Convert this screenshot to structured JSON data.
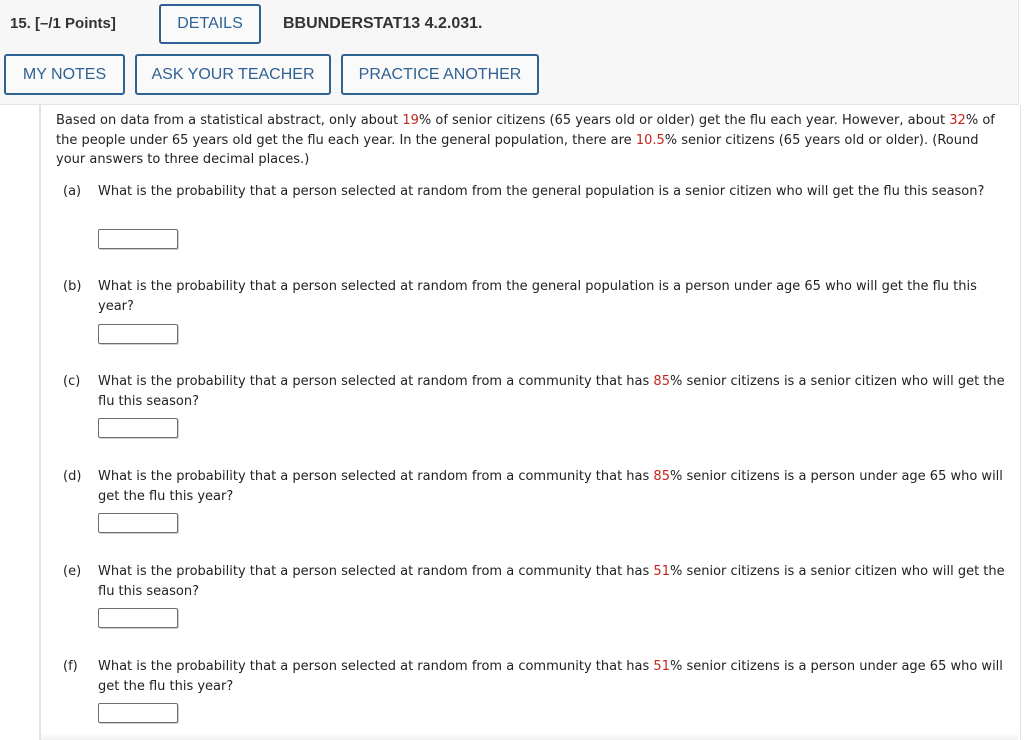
{
  "header": {
    "question_number": "15.  [–/1 Points]",
    "details_label": "DETAILS",
    "question_code": "BBUNDERSTAT13 4.2.031.",
    "my_notes_label": "MY NOTES",
    "ask_teacher_label": "ASK YOUR TEACHER",
    "practice_label": "PRACTICE ANOTHER"
  },
  "colors": {
    "accent": "#2f6193",
    "highlight": "#c4261d"
  },
  "intro": {
    "t1": "Based on data from a statistical abstract, only about ",
    "v1": "19",
    "t2": "% of senior citizens (65 years old or older) get the flu each year. However, about ",
    "v2": "32",
    "t3": "% of the people under 65 years old get the flu each year. In the general population, there are ",
    "v3": "10.5",
    "t4": "% senior citizens (65 years old or older). (Round your answers to three decimal places.)"
  },
  "parts": [
    {
      "label": "(a)",
      "text": "What is the probability that a person selected at random from the general population is a senior citizen who will get the flu this season?",
      "answer": ""
    },
    {
      "label": "(b)",
      "text": "What is the probability that a person selected at random from the general population is a person under age 65 who will get the flu this year?",
      "answer": ""
    },
    {
      "label": "(c)",
      "pre": "What is the probability that a person selected at random from a community that has ",
      "value": "85",
      "post": "% senior citizens is a senior citizen who will get the flu this season?",
      "answer": ""
    },
    {
      "label": "(d)",
      "pre": "What is the probability that a person selected at random from a community that has ",
      "value": "85",
      "post": "% senior citizens is a person under age 65 who will get the flu this year?",
      "answer": ""
    },
    {
      "label": "(e)",
      "pre": "What is the probability that a person selected at random from a community that has ",
      "value": "51",
      "post": "% senior citizens is a senior citizen who will get the flu this season?",
      "answer": ""
    },
    {
      "label": "(f)",
      "pre": "What is the probability that a person selected at random from a community that has ",
      "value": "51",
      "post": "% senior citizens is a person under age 65 who will get the flu this year?",
      "answer": ""
    }
  ]
}
